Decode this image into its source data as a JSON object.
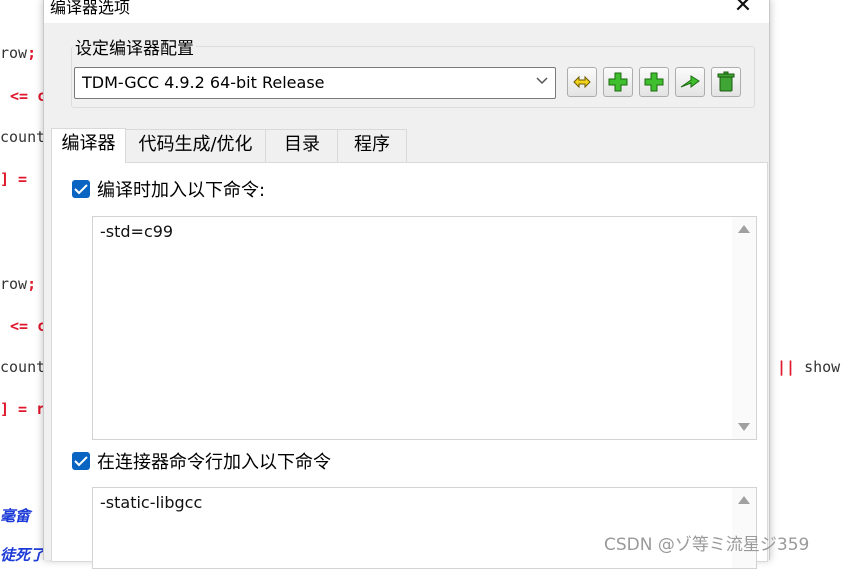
{
  "background_code": {
    "lines": [
      {
        "a": "row",
        "b": ";"
      },
      {
        "a": "",
        "b": "<= c"
      },
      {
        "a": "count",
        "b": ""
      },
      {
        "a": "",
        "b": "] ="
      },
      {
        "a": "row",
        "b": ";"
      },
      {
        "a": "",
        "b": "<= c"
      },
      {
        "a": "count",
        "b": ""
      },
      {
        "a": "",
        "b": "] = r"
      }
    ],
    "right_fragment_op": "||",
    "right_fragment_text": "show",
    "bottom_fragment_1": "毫畲",
    "bottom_fragment_2": "徒死了"
  },
  "dialog": {
    "title": "编译器选项",
    "close_glyph": "✕",
    "group_label": "设定编译器配置",
    "compiler_selected": "TDM-GCC 4.9.2 64-bit Release",
    "toolbar_icons": [
      "rename-icon",
      "add-icon",
      "add-copy-icon",
      "export-icon",
      "delete-icon"
    ],
    "tabs": [
      "编译器",
      "代码生成/优化",
      "目录",
      "程序"
    ],
    "compiler_cmd_checkbox_label": "编译时加入以下命令:",
    "compiler_cmd_value": "-std=c99",
    "linker_cmd_checkbox_label": "在连接器命令行加入以下命令",
    "linker_cmd_value": "-static-libgcc"
  },
  "watermark": "CSDN @ゾ等ミ流星ジ359",
  "colors": {
    "accent": "#0a64c2",
    "code_red": "#e0162b",
    "code_blue": "#1e3cd8"
  }
}
